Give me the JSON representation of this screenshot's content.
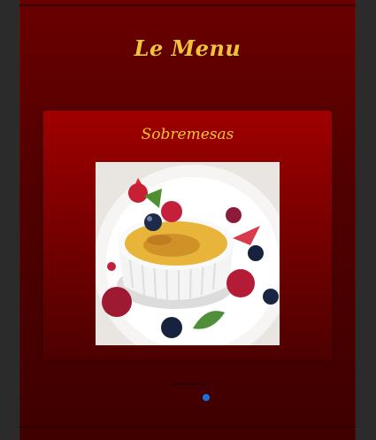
{
  "header": {
    "title": "Le Menu"
  },
  "card": {
    "title": "Sobremesas",
    "image_subject": "creme brulee dessert with berries"
  },
  "carousel": {
    "pages": 1,
    "active_index": 0,
    "active_color": "#1e6fe0"
  },
  "colors": {
    "accent": "#f2c23a",
    "background": "#5a0000"
  }
}
